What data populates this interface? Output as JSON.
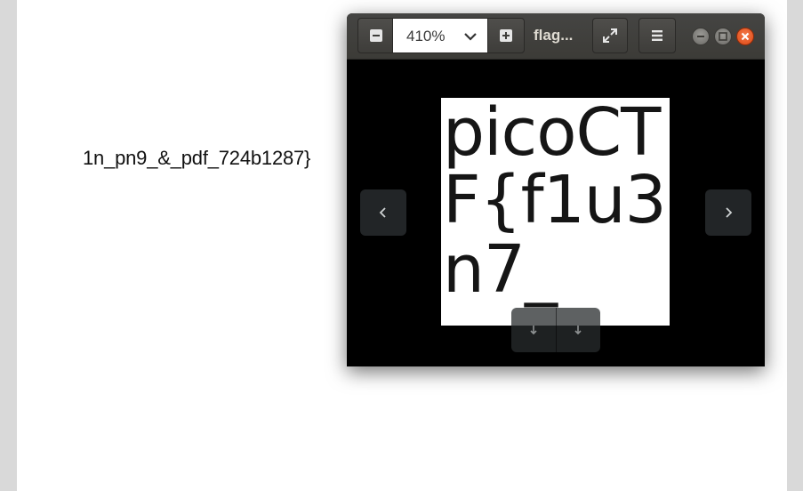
{
  "document": {
    "text": "1n_pn9_&_pdf_724b1287}"
  },
  "viewer": {
    "zoom_value": "410%",
    "file_title": "flag...",
    "image_lines": [
      "picoCT",
      "F{f1u3",
      "n7_"
    ],
    "icons": {
      "zoom_out": "minus-icon",
      "zoom_dropdown": "chevron-down-icon",
      "zoom_in": "plus-icon",
      "fullscreen": "fullscreen-icon",
      "menu": "hamburger-menu-icon",
      "minimize": "minimize-icon",
      "maximize": "maximize-icon",
      "close": "close-icon",
      "previous": "chevron-left-icon",
      "next": "chevron-right-icon",
      "rotate_left": "rotate-left-icon",
      "rotate_right": "rotate-right-icon"
    },
    "colors": {
      "titlebar": "#3c3b37",
      "close_button": "#dd4814",
      "canvas": "#000000"
    }
  }
}
